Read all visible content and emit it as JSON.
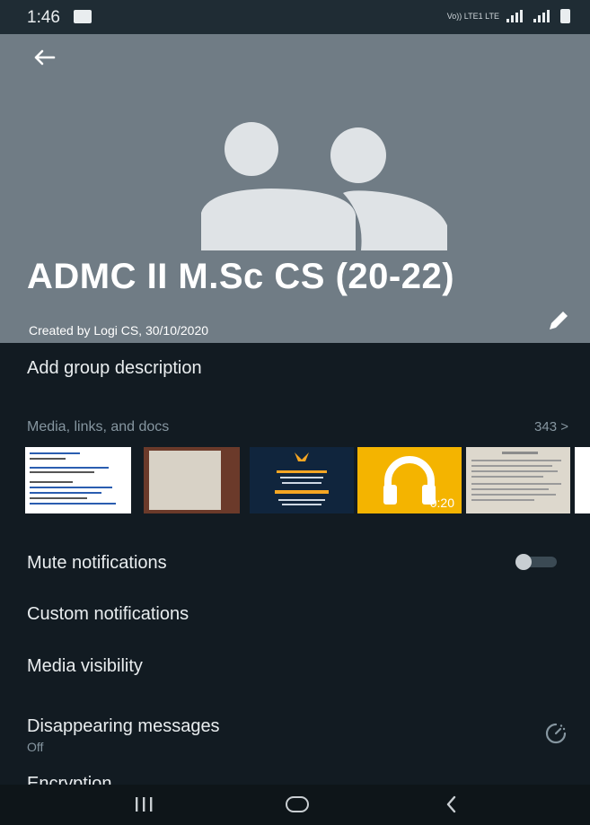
{
  "status_bar": {
    "time": "1:46",
    "network": "Vo)) LTE1 LTE"
  },
  "group": {
    "name": "ADMC II M.Sc CS (20-22)",
    "created_by": "Created by Logi CS, 30/10/2020"
  },
  "description": {
    "label": "Add group description"
  },
  "media": {
    "title": "Media, links, and docs",
    "count": "343 >",
    "audio_duration": "0:20"
  },
  "notifications": {
    "mute_label": "Mute notifications",
    "mute_enabled": false,
    "custom_label": "Custom notifications",
    "visibility_label": "Media visibility"
  },
  "disappearing": {
    "label": "Disappearing messages",
    "value": "Off"
  },
  "encryption": {
    "label": "Encryption"
  },
  "colors": {
    "background": "#121b22",
    "header": "#707c85",
    "audio_thumb": "#f4b400"
  }
}
